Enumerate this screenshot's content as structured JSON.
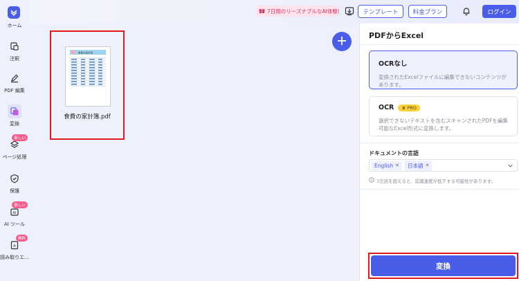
{
  "sidebar": {
    "items": [
      {
        "label": "ホーム",
        "icon": "home-icon"
      },
      {
        "label": "注釈",
        "icon": "annotate-icon"
      },
      {
        "label": "PDF 編集",
        "icon": "edit-pen-icon"
      },
      {
        "label": "変換",
        "icon": "convert-icon"
      },
      {
        "label": "ページ処理",
        "icon": "layers-icon",
        "badge": "新しい"
      },
      {
        "label": "保護",
        "icon": "shield-icon"
      },
      {
        "label": "AI ツール",
        "icon": "ai-tools-icon",
        "badge": "新しい"
      },
      {
        "label": "読み取りエ...",
        "icon": "reader-icon",
        "badge": "無料"
      }
    ]
  },
  "topbar": {
    "promo": "7日間のリーズナブルなAI体験！",
    "template_label": "テンプレート",
    "pricing_label": "料金プラン",
    "login_label": "ログイン"
  },
  "file": {
    "name": "食費の家計簿.pdf",
    "thumb_title": "食費の家計簿"
  },
  "panel": {
    "title": "PDFからExcel",
    "options": [
      {
        "title": "OCRなし",
        "desc": "変換されたExcelファイルに編集できないコンテンツがあります。",
        "selected": true
      },
      {
        "title": "OCR",
        "badge": "PRO",
        "desc": "選択できないテキストを含むスキャンされたPDFを編集可能なExcel形式に変換します。",
        "selected": false
      }
    ],
    "language_label": "ドキュメントの言語",
    "languages": [
      "English",
      "日本語"
    ],
    "note": "3言語を超えると、認識速度が低下する可能性があります。",
    "convert_label": "変換"
  },
  "colors": {
    "accent": "#4a5de8",
    "highlight_red": "#e0191f",
    "badge_pink": "#f25d8e",
    "pro_yellow": "#fbd23a"
  }
}
